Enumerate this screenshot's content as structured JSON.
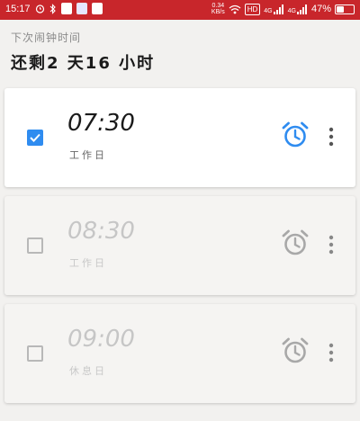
{
  "status_bar": {
    "time": "15:17",
    "speed_top": "0.34",
    "speed_bottom": "KB/s",
    "hd_label": "HD",
    "net1": "4G",
    "net2": "4G",
    "battery": "47%",
    "battery_level": 0.47,
    "bar_color": "#c8262b"
  },
  "header": {
    "subtitle": "下次闹钟时间",
    "remaining": "还剩2 天16 小时"
  },
  "alarms": [
    {
      "time": "07:30",
      "label": "工作日",
      "enabled": true
    },
    {
      "time": "08:30",
      "label": "工作日",
      "enabled": false
    },
    {
      "time": "09:00",
      "label": "休息日",
      "enabled": false
    }
  ],
  "colors": {
    "accent": "#2f8cf0",
    "inactive": "#a8a8a8"
  }
}
